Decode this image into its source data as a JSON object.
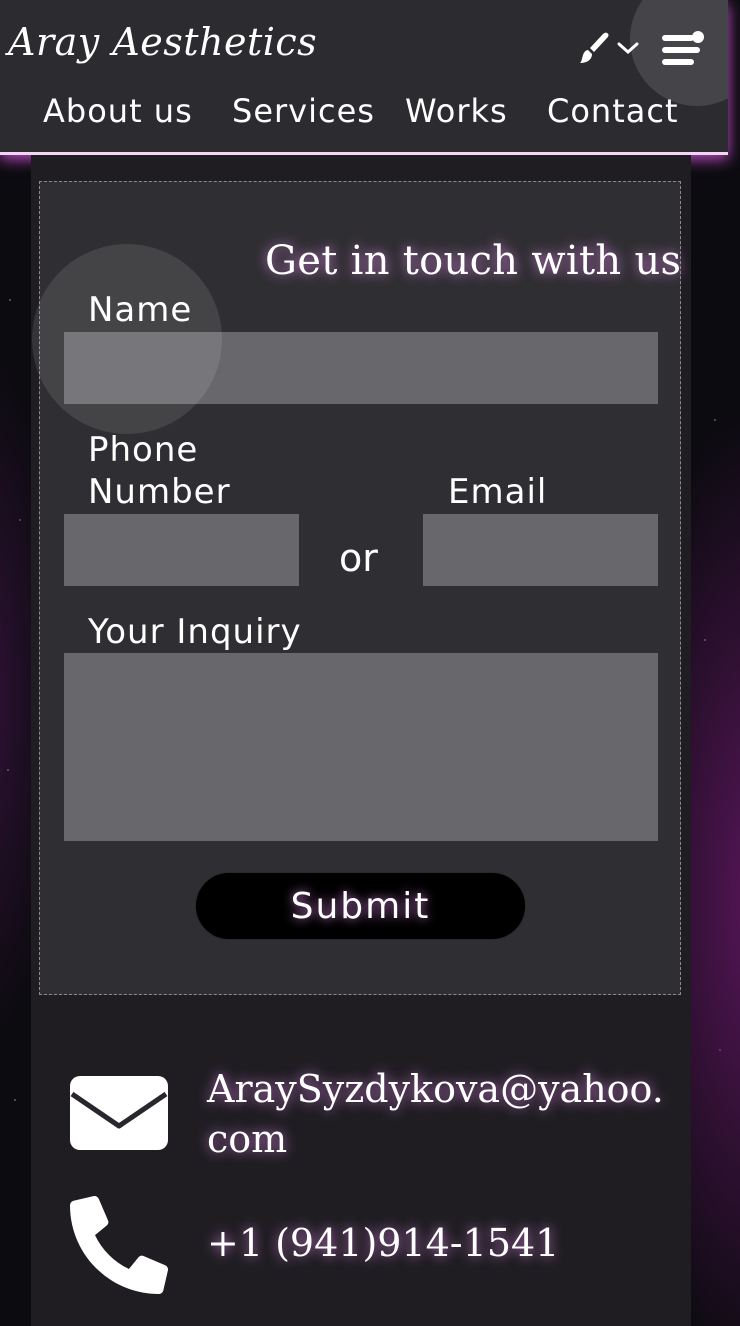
{
  "header": {
    "logo": "Aray Aesthetics",
    "theme_icon": "paintbrush-icon",
    "menu_icon": "hamburger-menu-icon",
    "nav": [
      {
        "label": "About us"
      },
      {
        "label": "Services"
      },
      {
        "label": "Works"
      },
      {
        "label": "Contact"
      }
    ]
  },
  "form": {
    "title": "Get in touch with us",
    "name_label": "Name",
    "name_value": "",
    "phone_label_line1": "Phone",
    "phone_label_line2": "Number",
    "phone_value": "",
    "or_text": "or",
    "email_label": "Email",
    "email_value": "",
    "inquiry_label": "Your Inquiry",
    "inquiry_value": "",
    "submit_label": "Submit"
  },
  "contact": {
    "email_line1": "AraySyzdykova@yahoo.",
    "email_line2": "com",
    "email_icon": "envelope-icon",
    "phone": "+1 (941)914-1541",
    "phone_icon": "phone-icon"
  },
  "colors": {
    "accent_glow": "#e08cf0",
    "header_bg": "#2c2b2f",
    "card_bg": "#2f2e32",
    "field_bg": "#68676b"
  }
}
